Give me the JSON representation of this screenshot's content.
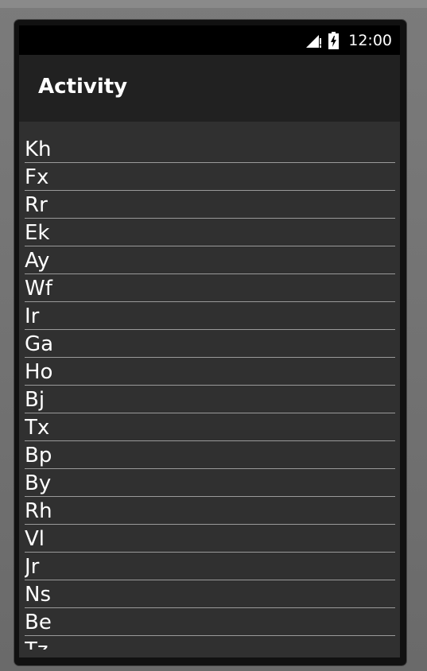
{
  "status_bar": {
    "time": "12:00",
    "icons": [
      "signal-icon",
      "battery-icon"
    ]
  },
  "action_bar": {
    "title": "Activity"
  },
  "list": {
    "items": [
      "Kh",
      "Fx",
      "Rr",
      "Ek",
      "Ay",
      "Wf",
      "Ir",
      "Ga",
      "Ho",
      "Bj",
      "Tx",
      "Bp",
      "By",
      "Rh",
      "Vl",
      "Jr",
      "Ns",
      "Be",
      "Tz"
    ]
  },
  "colors": {
    "background": "#303030",
    "action_bar": "#212121",
    "status_bar": "#000000",
    "text": "#ffffff",
    "divider": "#9a9a9a"
  }
}
